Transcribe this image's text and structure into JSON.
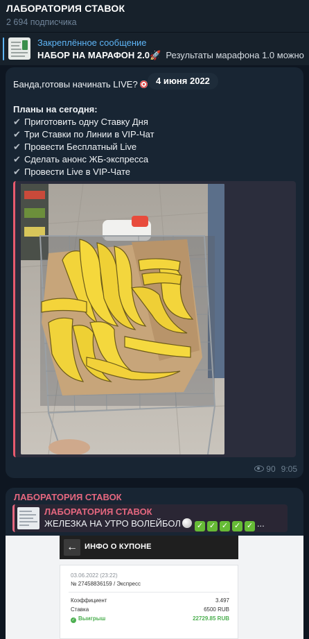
{
  "channel": {
    "title": "ЛАБОРАТОРИЯ СТАВОК",
    "subscribers": "2 694 подписчика"
  },
  "pinned": {
    "label": "Закреплённое сообщение",
    "title": "НАБОР НА МАРАФОН 2.0",
    "rocket": "🚀",
    "snippet": "Результаты марафона 1.0 можно"
  },
  "message1": {
    "intro": "Банда,готовы начинать LIVE?",
    "date": "4 июня 2022",
    "plans_title": "Планы на сегодня:",
    "check_glyph": "✔",
    "plans": [
      "Приготовить одну Ставку Дня",
      "Три Ставки по Линии в VIP-Чат",
      "Провести Бесплатный Live",
      "Сделать анонс ЖБ-экспресса",
      "Провести Live в VIP-Чате"
    ],
    "views": "90",
    "time": "9:05"
  },
  "message2": {
    "channel": "ЛАБОРАТОРИЯ СТАВОК",
    "forward_name": "ЛАБОРАТОРИЯ СТАВОК",
    "forward_text": "ЖЕЛЕЗКА НА УТРО ВОЛЕЙБОЛ",
    "checkmarks": [
      "✓",
      "✓",
      "✓",
      "✓",
      "✓"
    ],
    "ellipsis": "...",
    "screenshot": {
      "back_glyph": "←",
      "title": "ИНФО О КУПОНЕ",
      "date": "03.06.2022 (23:22)",
      "number": "№ 27458836159 / Экспресс",
      "rows": [
        {
          "label": "Коэффициент",
          "value": "3.497"
        },
        {
          "label": "Ставка",
          "value": "6500 RUB"
        }
      ],
      "win_label": "Выигрыш",
      "win_value": "22729.85 RUB"
    }
  }
}
